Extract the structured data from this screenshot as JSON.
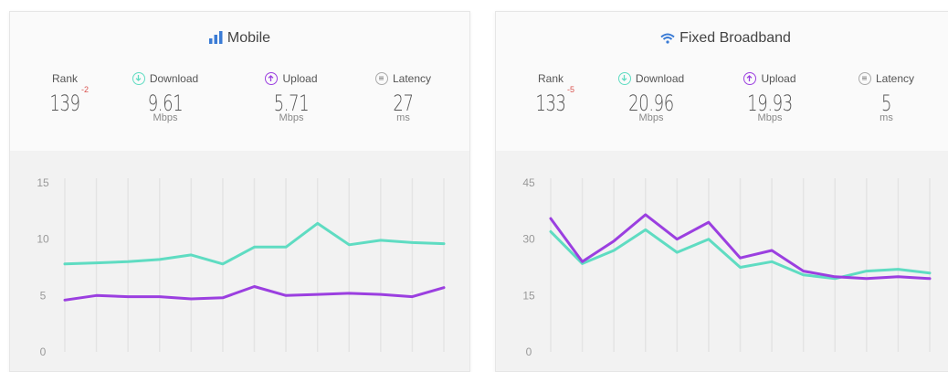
{
  "colors": {
    "download": "#5fdcc2",
    "upload": "#9b3fe0",
    "latency": "#aaaaaa",
    "rank_delta": "#d9534f",
    "title_icon_mobile": "#3a7bd5",
    "title_icon_fixed": "#3a7bd5"
  },
  "panels": [
    {
      "title": "Mobile",
      "icon": "signal-bars-icon",
      "rank_label": "Rank",
      "rank_value": "139",
      "rank_delta": "-2",
      "download_label": "Download",
      "download_value": "9.61",
      "download_unit": "Mbps",
      "upload_label": "Upload",
      "upload_value": "5.71",
      "upload_unit": "Mbps",
      "latency_label": "Latency",
      "latency_value": "27",
      "latency_unit": "ms"
    },
    {
      "title": "Fixed Broadband",
      "icon": "wifi-icon",
      "rank_label": "Rank",
      "rank_value": "133",
      "rank_delta": "-5",
      "download_label": "Download",
      "download_value": "20.96",
      "download_unit": "Mbps",
      "upload_label": "Upload",
      "upload_value": "19.93",
      "upload_unit": "Mbps",
      "latency_label": "Latency",
      "latency_value": "5",
      "latency_unit": "ms"
    }
  ],
  "chart_data": [
    {
      "type": "line",
      "title": "Mobile",
      "x": [
        1,
        2,
        3,
        4,
        5,
        6,
        7,
        8,
        9,
        10,
        11,
        12,
        13
      ],
      "yticks": [
        0,
        5,
        10,
        15
      ],
      "ylim": [
        0,
        15
      ],
      "grid": "vertical",
      "series": [
        {
          "name": "Download",
          "values": [
            7.8,
            7.9,
            8.0,
            8.2,
            8.6,
            7.8,
            9.3,
            9.3,
            11.4,
            9.5,
            9.9,
            9.7,
            9.6
          ]
        },
        {
          "name": "Upload",
          "values": [
            4.6,
            5.0,
            4.9,
            4.9,
            4.7,
            4.8,
            5.8,
            5.0,
            5.1,
            5.2,
            5.1,
            4.9,
            5.7
          ]
        }
      ]
    },
    {
      "type": "line",
      "title": "Fixed Broadband",
      "x": [
        1,
        2,
        3,
        4,
        5,
        6,
        7,
        8,
        9,
        10,
        11,
        12,
        13
      ],
      "yticks": [
        0,
        15,
        30,
        45
      ],
      "ylim": [
        0,
        45
      ],
      "grid": "vertical",
      "series": [
        {
          "name": "Download",
          "values": [
            32,
            23.5,
            27,
            32.5,
            26.5,
            30,
            22.5,
            24,
            20.5,
            19.5,
            21.5,
            22,
            21
          ]
        },
        {
          "name": "Upload",
          "values": [
            35.5,
            24,
            29.5,
            36.5,
            30,
            34.5,
            25,
            27,
            21.5,
            20,
            19.5,
            20,
            19.5
          ]
        }
      ]
    }
  ]
}
